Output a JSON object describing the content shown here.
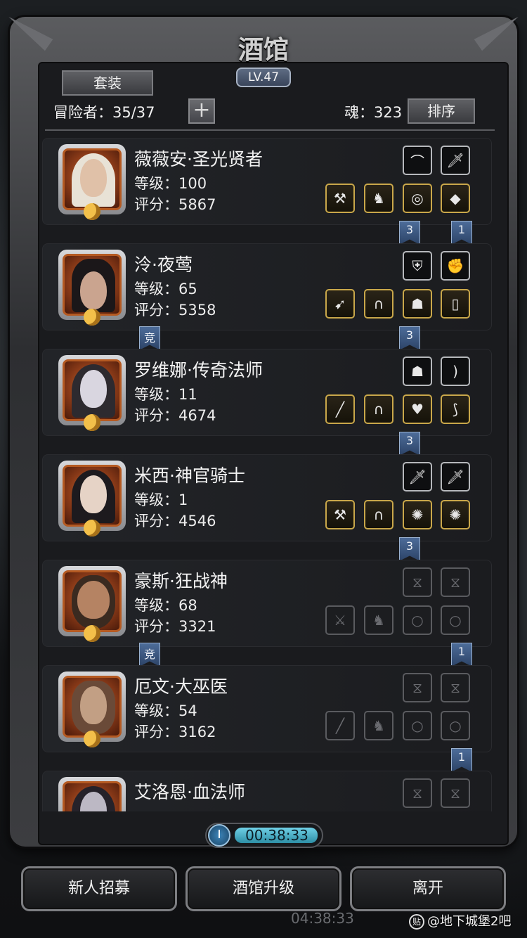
{
  "header": {
    "title": "酒馆",
    "level": "LV.47",
    "set_button": "套装",
    "adventurers_label": "冒险者：35/37",
    "add_button": "+",
    "soul_label": "魂：323",
    "sort_button": "排序"
  },
  "heroes": [
    {
      "name": "薇薇安·圣光贤者",
      "level": "等级：100",
      "score": "评分：5867"
    },
    {
      "name": "泠·夜莺",
      "level": "等级：65",
      "score": "评分：5358"
    },
    {
      "name": "罗维娜·传奇法师",
      "level": "等级：11",
      "score": "评分：4674"
    },
    {
      "name": "米西·神官骑士",
      "level": "等级：1",
      "score": "评分：4546"
    },
    {
      "name": "豪斯·狂战神",
      "level": "等级：68",
      "score": "评分：3321"
    },
    {
      "name": "厄文·大巫医",
      "level": "等级：54",
      "score": "评分：3162"
    },
    {
      "name": "艾洛恩·血法师",
      "level": "",
      "score": ""
    }
  ],
  "badges": {
    "b1": "3",
    "b2": "1",
    "b3": "竞",
    "b4": "3",
    "b5": "3",
    "b6": "3",
    "b7": "竞",
    "b8": "1",
    "b9": "1"
  },
  "timer": "00:38:33",
  "bottom": {
    "recruit": "新人招募",
    "upgrade": "酒馆升级",
    "leave": "离开"
  },
  "ghost_timer": "04:38:33",
  "watermark": "@地下城堡2吧",
  "watermark_icon": "贴"
}
